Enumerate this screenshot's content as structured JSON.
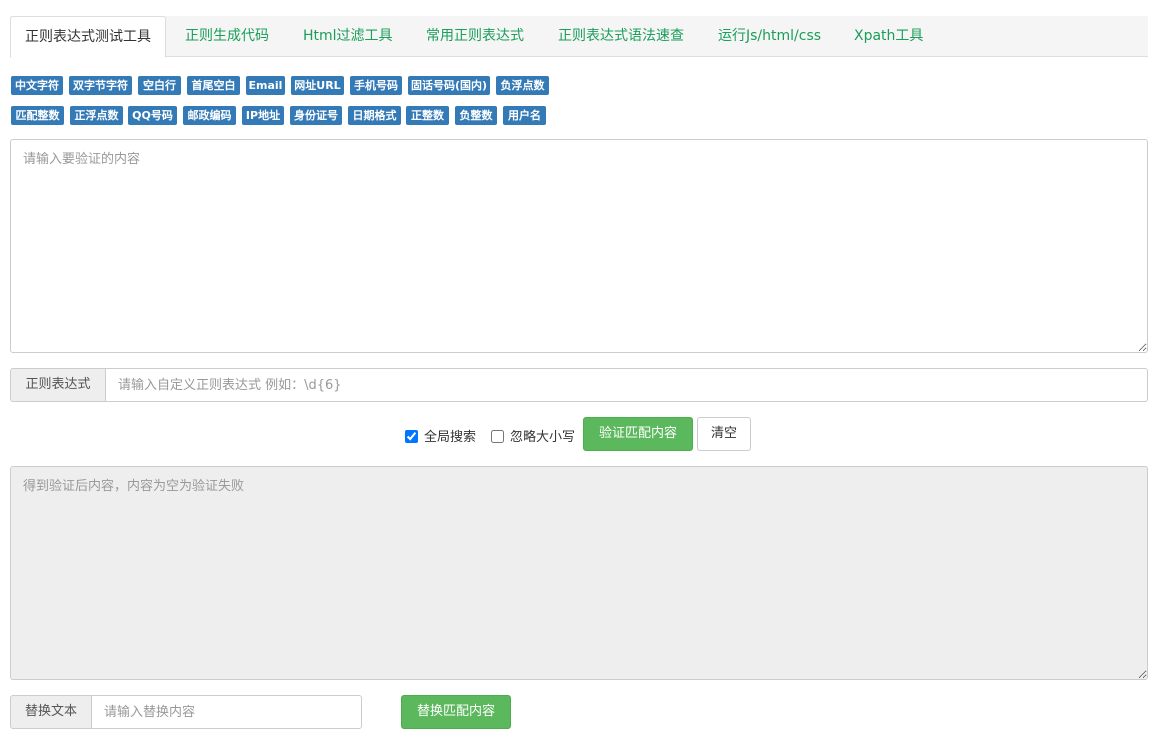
{
  "tabs": [
    {
      "label": "正则表达式测试工具",
      "active": true
    },
    {
      "label": "正则生成代码"
    },
    {
      "label": "Html过滤工具"
    },
    {
      "label": "常用正则表达式"
    },
    {
      "label": "正则表达式语法速查"
    },
    {
      "label": "运行Js/html/css"
    },
    {
      "label": "Xpath工具"
    }
  ],
  "quick_tags_row1": [
    "中文字符",
    "双字节字符",
    "空白行",
    "首尾空白",
    "Email",
    "网址URL",
    "手机号码",
    "固话号码(国内)",
    "负浮点数"
  ],
  "quick_tags_row2": [
    "匹配整数",
    "正浮点数",
    "QQ号码",
    "邮政编码",
    "IP地址",
    "身份证号",
    "日期格式",
    "正整数",
    "负整数",
    "用户名"
  ],
  "input_area": {
    "placeholder": "请输入要验证的内容",
    "value": ""
  },
  "regex": {
    "label": "正则表达式",
    "placeholder": "请输入自定义正则表达式 例如：\\d{6}",
    "value": ""
  },
  "options": {
    "global_label": "全局搜索",
    "global_checked": true,
    "ignorecase_label": "忽略大小写",
    "ignorecase_checked": false
  },
  "buttons": {
    "verify": "验证匹配内容",
    "clear": "清空",
    "replace": "替换匹配内容"
  },
  "result_area": {
    "placeholder": "得到验证后内容，内容为空为验证失败"
  },
  "replace": {
    "label": "替换文本",
    "placeholder": "请输入替换内容"
  },
  "colors": {
    "tag_blue": "#337ab7",
    "accent_green": "#5cb85c",
    "tab_link_green": "#1a9e5a"
  }
}
